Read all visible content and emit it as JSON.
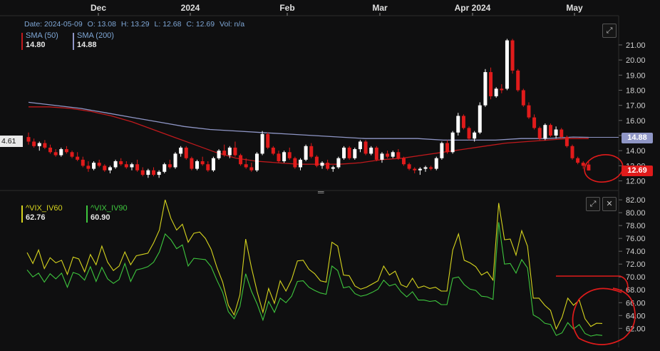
{
  "chart_data": [
    {
      "type": "candlestick",
      "x_ticks": [
        "Dec",
        "2024",
        "Feb",
        "Mar",
        "Apr 2024",
        "May"
      ],
      "y_ticks": [
        "21.00",
        "20.00",
        "19.00",
        "18.00",
        "17.00",
        "16.00",
        "15.00",
        "14.00",
        "13.00",
        "12.00"
      ],
      "ylim": [
        11.6,
        21.8
      ],
      "info": {
        "date_label": "Date:",
        "date": "2024-05-09",
        "open_label": "O:",
        "open": "13.08",
        "high_label": "H:",
        "high": "13.29",
        "low_label": "L:",
        "low": "12.68",
        "close_label": "C:",
        "close": "12.69",
        "vol_label": "Vol:",
        "vol": "n/a"
      },
      "legend": [
        {
          "name": "SMA (50)",
          "value": "14.80",
          "color": "#c0191c"
        },
        {
          "name": "SMA (200)",
          "value": "14.88",
          "color": "#8f96c6"
        }
      ],
      "left_axis_label": "4.61",
      "last_price_tags": [
        {
          "text": "14.88",
          "value": 14.88,
          "color": "#8f96c6"
        },
        {
          "text": "12.69",
          "value": 12.69,
          "color": "#e01b1b"
        }
      ],
      "up_color": "#ffffff",
      "down_color": "#e01b1b",
      "candles": [
        [
          14.9,
          15.2,
          14.4,
          14.6
        ],
        [
          14.6,
          14.8,
          14.2,
          14.3
        ],
        [
          14.3,
          14.6,
          14.0,
          14.5
        ],
        [
          14.5,
          14.7,
          14.1,
          14.2
        ],
        [
          14.2,
          14.4,
          13.8,
          13.9
        ],
        [
          13.9,
          14.1,
          13.6,
          13.7
        ],
        [
          13.7,
          14.2,
          13.6,
          14.1
        ],
        [
          14.1,
          14.3,
          13.8,
          13.9
        ],
        [
          13.9,
          14.0,
          13.5,
          13.6
        ],
        [
          13.6,
          13.9,
          13.3,
          13.4
        ],
        [
          13.4,
          13.6,
          12.9,
          13.0
        ],
        [
          13.0,
          13.3,
          12.6,
          12.8
        ],
        [
          12.8,
          13.3,
          12.7,
          13.2
        ],
        [
          13.2,
          13.4,
          12.9,
          13.0
        ],
        [
          13.0,
          13.1,
          12.6,
          12.7
        ],
        [
          12.7,
          13.0,
          12.5,
          12.9
        ],
        [
          12.9,
          13.4,
          12.8,
          13.3
        ],
        [
          13.3,
          13.5,
          13.0,
          13.1
        ],
        [
          13.1,
          13.3,
          12.8,
          12.9
        ],
        [
          12.9,
          13.2,
          12.7,
          13.1
        ],
        [
          13.1,
          13.4,
          12.6,
          12.7
        ],
        [
          12.7,
          12.9,
          12.3,
          12.4
        ],
        [
          12.4,
          12.8,
          12.2,
          12.7
        ],
        [
          12.7,
          12.9,
          12.3,
          12.4
        ],
        [
          12.4,
          12.7,
          12.2,
          12.6
        ],
        [
          12.6,
          13.2,
          12.5,
          13.1
        ],
        [
          13.1,
          13.4,
          12.8,
          12.9
        ],
        [
          12.9,
          13.9,
          12.8,
          13.8
        ],
        [
          13.8,
          14.3,
          13.6,
          14.2
        ],
        [
          14.2,
          14.3,
          13.4,
          13.5
        ],
        [
          13.5,
          13.6,
          12.7,
          12.8
        ],
        [
          12.8,
          13.4,
          12.7,
          13.3
        ],
        [
          13.3,
          13.6,
          13.0,
          13.1
        ],
        [
          13.1,
          13.3,
          12.6,
          12.7
        ],
        [
          12.7,
          13.6,
          12.6,
          13.5
        ],
        [
          13.5,
          14.1,
          13.4,
          14.0
        ],
        [
          14.0,
          14.4,
          13.6,
          13.7
        ],
        [
          13.7,
          14.3,
          13.5,
          14.2
        ],
        [
          14.2,
          14.6,
          13.6,
          13.7
        ],
        [
          13.7,
          13.8,
          13.0,
          13.1
        ],
        [
          13.1,
          13.5,
          12.8,
          12.9
        ],
        [
          12.9,
          13.2,
          12.6,
          12.7
        ],
        [
          12.7,
          13.9,
          12.6,
          13.8
        ],
        [
          13.8,
          15.3,
          13.7,
          15.1
        ],
        [
          15.1,
          15.2,
          14.1,
          14.2
        ],
        [
          14.2,
          14.3,
          13.7,
          13.8
        ],
        [
          13.8,
          14.0,
          13.2,
          13.3
        ],
        [
          13.3,
          14.0,
          13.2,
          13.9
        ],
        [
          13.9,
          14.2,
          13.4,
          13.5
        ],
        [
          13.5,
          13.6,
          12.8,
          12.9
        ],
        [
          12.9,
          13.5,
          12.7,
          13.4
        ],
        [
          13.4,
          14.4,
          13.3,
          14.3
        ],
        [
          14.3,
          14.5,
          13.5,
          13.6
        ],
        [
          13.6,
          13.7,
          12.9,
          13.0
        ],
        [
          13.0,
          13.3,
          12.8,
          13.2
        ],
        [
          13.2,
          13.4,
          12.7,
          12.8
        ],
        [
          12.8,
          13.0,
          12.6,
          12.9
        ],
        [
          12.9,
          13.6,
          12.8,
          13.5
        ],
        [
          13.5,
          14.3,
          13.4,
          14.2
        ],
        [
          14.2,
          14.3,
          13.4,
          13.5
        ],
        [
          13.5,
          14.2,
          13.4,
          14.1
        ],
        [
          14.1,
          14.7,
          13.9,
          14.6
        ],
        [
          14.6,
          14.7,
          13.7,
          13.8
        ],
        [
          13.8,
          14.3,
          13.7,
          14.2
        ],
        [
          14.2,
          14.3,
          13.3,
          13.4
        ],
        [
          13.4,
          13.9,
          13.2,
          13.8
        ],
        [
          13.8,
          14.0,
          13.5,
          13.6
        ],
        [
          13.6,
          14.0,
          13.5,
          13.9
        ],
        [
          13.9,
          14.1,
          13.4,
          13.5
        ],
        [
          13.5,
          13.6,
          13.0,
          13.1
        ],
        [
          13.1,
          13.2,
          12.7,
          12.8
        ],
        [
          12.8,
          12.9,
          12.5,
          12.7
        ],
        [
          12.7,
          12.9,
          12.4,
          12.8
        ],
        [
          12.8,
          13.0,
          12.6,
          12.9
        ],
        [
          12.9,
          13.0,
          12.7,
          12.8
        ],
        [
          12.8,
          13.6,
          12.7,
          13.5
        ],
        [
          13.5,
          14.6,
          13.4,
          14.5
        ],
        [
          14.5,
          14.7,
          13.8,
          13.9
        ],
        [
          13.9,
          15.3,
          13.8,
          15.2
        ],
        [
          15.2,
          16.5,
          15.0,
          16.3
        ],
        [
          16.3,
          16.4,
          15.4,
          15.5
        ],
        [
          15.5,
          15.6,
          14.7,
          14.8
        ],
        [
          14.8,
          15.3,
          14.6,
          15.2
        ],
        [
          15.2,
          17.2,
          15.1,
          17.0
        ],
        [
          17.0,
          19.4,
          16.9,
          19.2
        ],
        [
          19.2,
          19.5,
          17.4,
          17.6
        ],
        [
          17.6,
          18.2,
          17.5,
          18.1
        ],
        [
          18.1,
          18.4,
          17.8,
          18.0
        ],
        [
          18.1,
          21.4,
          18.0,
          21.3
        ],
        [
          21.3,
          21.4,
          19.1,
          19.3
        ],
        [
          19.3,
          19.4,
          17.9,
          18.0
        ],
        [
          18.0,
          18.1,
          16.9,
          17.0
        ],
        [
          17.0,
          17.2,
          16.1,
          16.2
        ],
        [
          16.2,
          16.4,
          15.4,
          15.5
        ],
        [
          15.5,
          15.6,
          14.7,
          14.8
        ],
        [
          14.8,
          15.8,
          14.7,
          15.7
        ],
        [
          15.7,
          15.8,
          14.9,
          15.0
        ],
        [
          15.0,
          15.6,
          14.8,
          15.4
        ],
        [
          15.4,
          15.5,
          14.8,
          14.9
        ],
        [
          14.9,
          15.0,
          14.2,
          14.3
        ],
        [
          14.3,
          14.4,
          13.4,
          13.5
        ],
        [
          13.5,
          13.6,
          13.1,
          13.2
        ],
        [
          13.2,
          13.3,
          12.8,
          13.0
        ],
        [
          13.08,
          13.29,
          12.68,
          12.69
        ]
      ],
      "sma50": [
        [
          0,
          16.9
        ],
        [
          8,
          16.9
        ],
        [
          16,
          16.8
        ],
        [
          24,
          16.6
        ],
        [
          32,
          16.3
        ],
        [
          40,
          15.9
        ],
        [
          48,
          15.4
        ],
        [
          56,
          14.9
        ],
        [
          64,
          14.4
        ],
        [
          72,
          13.9
        ],
        [
          80,
          13.5
        ],
        [
          88,
          13.3
        ],
        [
          96,
          13.2
        ],
        [
          104,
          13.1
        ],
        [
          112,
          13.1
        ],
        [
          120,
          13.1
        ],
        [
          128,
          13.2
        ],
        [
          136,
          13.4
        ],
        [
          144,
          13.5
        ],
        [
          152,
          13.7
        ],
        [
          160,
          13.9
        ],
        [
          168,
          14.1
        ],
        [
          176,
          14.3
        ],
        [
          184,
          14.5
        ],
        [
          192,
          14.6
        ],
        [
          200,
          14.7
        ],
        [
          208,
          14.8
        ],
        [
          216,
          14.8
        ]
      ],
      "sma200": [
        [
          0,
          17.2
        ],
        [
          10,
          17.0
        ],
        [
          20,
          16.8
        ],
        [
          30,
          16.5
        ],
        [
          40,
          16.2
        ],
        [
          50,
          15.9
        ],
        [
          60,
          15.6
        ],
        [
          70,
          15.4
        ],
        [
          80,
          15.3
        ],
        [
          90,
          15.2
        ],
        [
          100,
          15.1
        ],
        [
          110,
          15.0
        ],
        [
          120,
          14.9
        ],
        [
          130,
          14.8
        ],
        [
          140,
          14.8
        ],
        [
          150,
          14.8
        ],
        [
          160,
          14.7
        ],
        [
          170,
          14.7
        ],
        [
          180,
          14.7
        ],
        [
          190,
          14.8
        ],
        [
          200,
          14.8
        ],
        [
          210,
          14.9
        ],
        [
          216,
          14.88
        ]
      ]
    },
    {
      "type": "line",
      "y_ticks": [
        "82.00",
        "80.00",
        "78.00",
        "76.00",
        "74.00",
        "72.00",
        "70.00",
        "68.00",
        "66.00",
        "64.00",
        "62.00"
      ],
      "ylim": [
        60.7,
        82.9
      ],
      "series": [
        {
          "name": "^VIX_IV60",
          "value": "62.76",
          "color": "#d6d41e",
          "values": [
            73.8,
            72.1,
            74.2,
            71.3,
            73.0,
            72.2,
            72.6,
            70.4,
            73.1,
            72.8,
            70.8,
            73.5,
            71.9,
            74.8,
            72.3,
            71.0,
            71.7,
            73.9,
            71.9,
            73.3,
            73.5,
            73.7,
            75.3,
            77.3,
            82.0,
            79.1,
            77.3,
            78.2,
            75.4,
            76.8,
            77.0,
            76.0,
            74.3,
            71.5,
            69.2,
            65.6,
            64.1,
            67.2,
            75.9,
            71.5,
            67.7,
            64.5,
            68.2,
            65.9,
            69.4,
            67.8,
            69.6,
            72.5,
            72.6,
            71.2,
            70.5,
            69.4,
            69.2,
            75.4,
            74.8,
            70.3,
            70.2,
            68.6,
            68.1,
            68.4,
            68.9,
            69.4,
            71.7,
            70.3,
            70.9,
            68.8,
            68.4,
            69.8,
            68.3,
            68.6,
            68.2,
            68.4,
            67.8,
            67.8,
            74.2,
            76.7,
            72.6,
            72.2,
            71.6,
            70.3,
            70.8,
            69.5,
            81.5,
            75.8,
            75.9,
            73.4,
            77.2,
            74.8,
            66.7,
            66.7,
            65.6,
            64.8,
            61.9,
            63.7,
            66.7,
            65.6,
            66.4,
            63.5,
            62.3,
            62.8,
            62.76
          ]
        },
        {
          "name": "^VIX_IV90",
          "value": "60.90",
          "color": "#3ec73e",
          "values": [
            71.1,
            70.0,
            70.6,
            69.2,
            70.5,
            69.7,
            70.6,
            68.4,
            70.7,
            70.4,
            69.5,
            71.6,
            69.3,
            71.5,
            69.7,
            69.0,
            69.6,
            72.1,
            69.3,
            71.1,
            71.3,
            71.6,
            72.3,
            73.9,
            76.7,
            75.8,
            74.4,
            75.0,
            71.7,
            72.9,
            72.8,
            72.7,
            71.6,
            69.5,
            67.6,
            64.6,
            63.5,
            65.4,
            70.5,
            67.8,
            65.8,
            63.3,
            66.2,
            64.5,
            66.7,
            66.0,
            67.0,
            69.3,
            69.4,
            68.4,
            67.9,
            67.5,
            67.3,
            71.7,
            71.0,
            68.3,
            68.5,
            67.4,
            67.0,
            67.2,
            67.6,
            68.1,
            69.5,
            68.6,
            68.9,
            67.7,
            66.9,
            67.7,
            66.4,
            66.4,
            66.2,
            66.3,
            65.7,
            65.7,
            69.8,
            70.0,
            68.8,
            68.1,
            67.9,
            67.0,
            66.9,
            66.5,
            78.5,
            72.0,
            72.1,
            70.6,
            72.7,
            71.4,
            64.1,
            63.6,
            62.8,
            62.6,
            60.9,
            61.3,
            62.9,
            61.9,
            62.6,
            61.2,
            60.8,
            61.0,
            60.9
          ]
        }
      ]
    }
  ]
}
